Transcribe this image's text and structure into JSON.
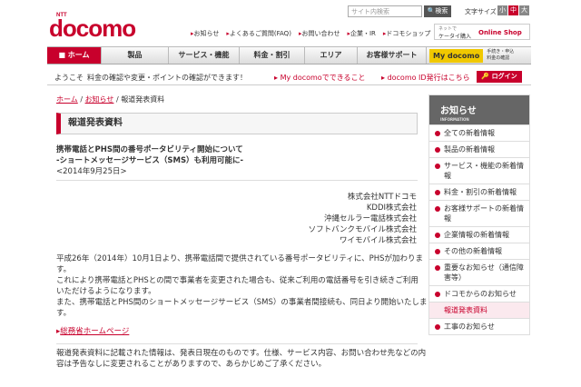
{
  "header": {
    "brand_ntt": "NTT",
    "brand": "docomo",
    "top_links": [
      "お知らせ",
      "よくあるご質問(FAQ)",
      "お問い合わせ",
      "企業・IR",
      "ドコモショップ"
    ],
    "search_placeholder": "サイト内検索",
    "search_button": "検索",
    "font_size_label": "文字サイズ",
    "font_sizes": [
      "小",
      "中",
      "大"
    ],
    "promo_small": "ネットで",
    "promo_main": "ケータイ購入",
    "promo_shop": "Online Shop"
  },
  "nav": {
    "items": [
      "ホーム",
      "製品",
      "サービス・機能",
      "料金・割引",
      "エリア",
      "お客様サポート",
      "My docomo"
    ],
    "apply_text": "手続き・申込",
    "apply_sub": "料金の確認"
  },
  "bar2": {
    "welcome": "ようこそ",
    "message": "料金の確認や変更・ポイントの確認ができます！",
    "link1": "My docomoでできること",
    "link2": "docomo ID発行はこちら",
    "login": "ログイン"
  },
  "breadcrumb": {
    "home": "ホーム",
    "news": "お知らせ",
    "current": "報道発表資料",
    "sep": "/"
  },
  "page_title": "報道発表資料",
  "article": {
    "headline": "携帯電話とPHS間の番号ポータビリティ開始について",
    "subheadline": "-ショートメッセージサービス（SMS）も利用可能に-",
    "date": "<2014年9月25日>",
    "companies": [
      "株式会社NTTドコモ",
      "KDDI株式会社",
      "沖縄セルラー電話株式会社",
      "ソフトバンクモバイル株式会社",
      "ワイモバイル株式会社"
    ],
    "para1": "平成26年（2014年）10月1日より、携帯電話間で提供されている番号ポータビリティに、PHSが加わりま",
    "para1b": "す。",
    "para2": "これにより携帯電話とPHSとの間で事業者を変更された場合も、従来ご利用の電話番号を引き続きご利用",
    "para2b": "いただけるようになります。",
    "para3": "また、携帯電話とPHS間のショートメッセージサービス（SMS）の事業者間接続も、同日より開始いたしま",
    "para3b": "す。",
    "link": "総務省ホームページ",
    "note1": "報道発表資料に記載された情報は、発表日現在のものです。仕様、サービス内容、お問い合わせ先などの内",
    "note2": "容は予告なしに変更されることがありますので、あらかじめご了承ください。"
  },
  "sidebar": {
    "title": "お知らせ",
    "subtitle": "INFORMATION",
    "items": [
      "全ての新着情報",
      "製品の新着情報",
      "サービス・機能の新着情報",
      "料金・割引の新着情報",
      "お客様サポートの新着情報",
      "企業情報の新着情報",
      "その他の新着情報",
      "重要なお知らせ（通信障害等）",
      "ドコモからのお知らせ",
      "報道発表資料",
      "工事のお知らせ"
    ]
  },
  "colors": {
    "brand": "#c8002c",
    "my_docomo": "#f0c800"
  }
}
